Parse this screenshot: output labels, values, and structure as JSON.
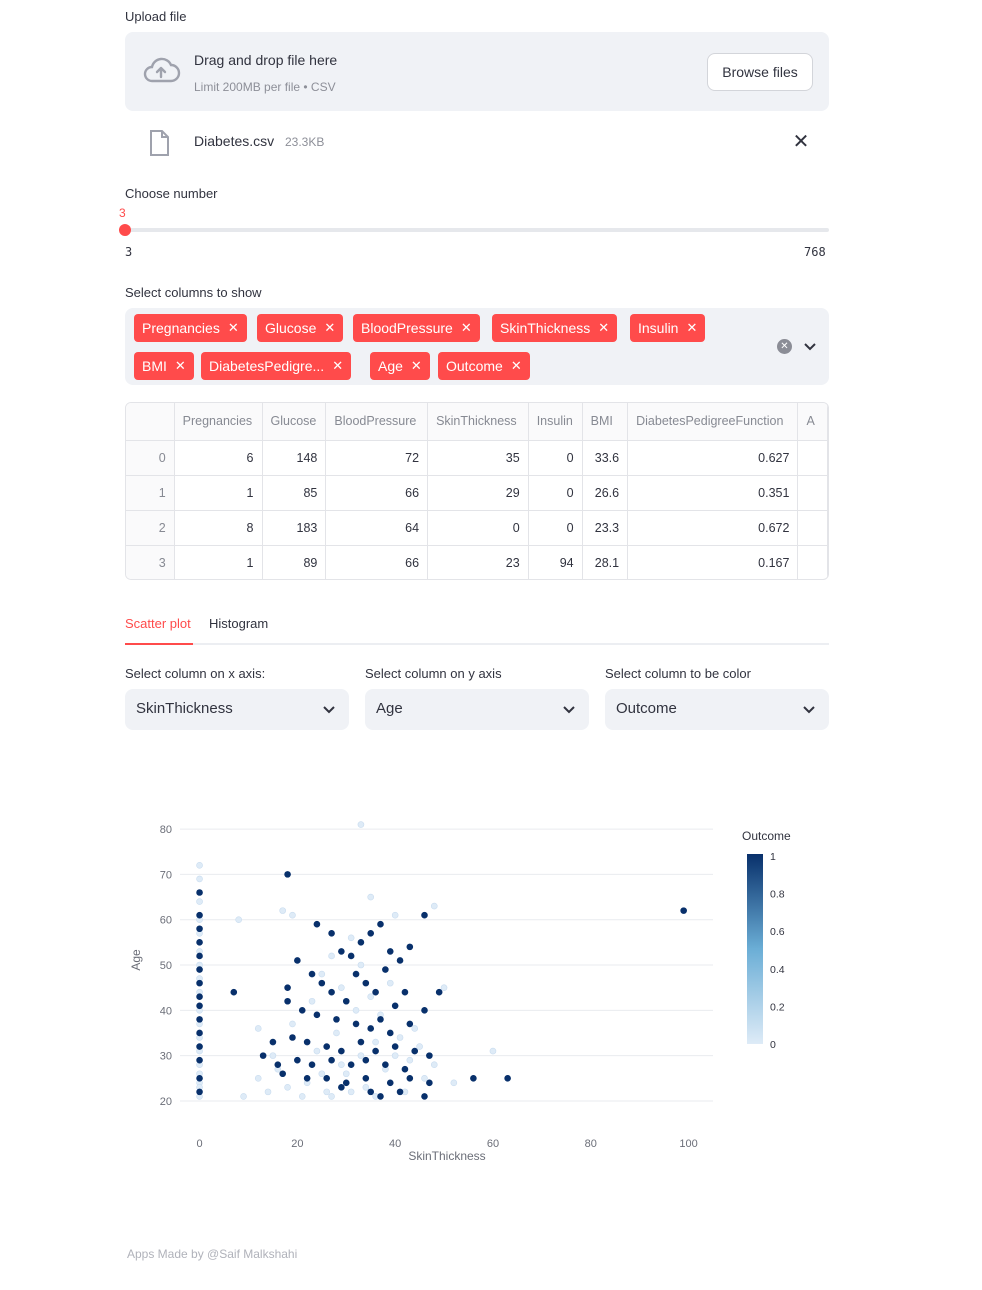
{
  "uploader": {
    "label": "Upload file",
    "drop_title": "Drag and drop file here",
    "drop_subtitle": "Limit 200MB per file • CSV",
    "browse_label": "Browse files",
    "file_name": "Diabetes.csv",
    "file_size": "23.3KB",
    "icons": [
      "cloud-upload-icon",
      "file-icon",
      "close-icon"
    ]
  },
  "slider": {
    "label": "Choose number",
    "value": "3",
    "min": "3",
    "max": "768",
    "accent": "#ff4b4b"
  },
  "multiselect": {
    "label": "Select columns to show",
    "chips": [
      "Pregnancies",
      "Glucose",
      "BloodPressure",
      "SkinThickness",
      "Insulin",
      "BMI",
      "DiabetesPedigre...",
      "Age",
      "Outcome"
    ]
  },
  "table": {
    "columns": [
      "Pregnancies",
      "Glucose",
      "BloodPressure",
      "SkinThickness",
      "Insulin",
      "BMI",
      "DiabetesPedigreeFunction",
      "A"
    ],
    "rows": [
      {
        "index": "0",
        "cells": [
          "6",
          "148",
          "72",
          "35",
          "0",
          "33.6",
          "0.627",
          ""
        ]
      },
      {
        "index": "1",
        "cells": [
          "1",
          "85",
          "66",
          "29",
          "0",
          "26.6",
          "0.351",
          ""
        ]
      },
      {
        "index": "2",
        "cells": [
          "8",
          "183",
          "64",
          "0",
          "0",
          "23.3",
          "0.672",
          ""
        ]
      },
      {
        "index": "3",
        "cells": [
          "1",
          "89",
          "66",
          "23",
          "94",
          "28.1",
          "0.167",
          ""
        ]
      }
    ]
  },
  "tabs": {
    "items": [
      "Scatter plot",
      "Histogram"
    ],
    "active": "Scatter plot"
  },
  "selects": [
    {
      "label": "Select column on x axis:",
      "value": "SkinThickness"
    },
    {
      "label": "Select column on y axis",
      "value": "Age"
    },
    {
      "label": "Select column to be color",
      "value": "Outcome"
    }
  ],
  "chart_data": {
    "type": "scatter",
    "xlabel": "SkinThickness",
    "ylabel": "Age",
    "xlim": [
      -4,
      105
    ],
    "ylim": [
      18,
      82
    ],
    "x_ticks": [
      0,
      20,
      40,
      60,
      80,
      100
    ],
    "y_ticks": [
      20,
      30,
      40,
      50,
      60,
      70,
      80
    ],
    "colorbar": {
      "title": "Outcome",
      "ticks": [
        "1",
        "0.8",
        "0.6",
        "0.4",
        "0.2",
        "0"
      ],
      "low_color": "#deebf7",
      "high_color": "#08306b"
    },
    "grid": true,
    "points": [
      {
        "x": 18,
        "y": 70,
        "c": 1
      },
      {
        "x": 99,
        "y": 62,
        "c": 1
      },
      {
        "x": 7,
        "y": 44,
        "c": 1
      },
      {
        "x": 0,
        "y": 66,
        "c": 1
      },
      {
        "x": 0,
        "y": 61,
        "c": 1
      },
      {
        "x": 0,
        "y": 58,
        "c": 1
      },
      {
        "x": 0,
        "y": 55,
        "c": 1
      },
      {
        "x": 0,
        "y": 52,
        "c": 1
      },
      {
        "x": 0,
        "y": 49,
        "c": 1
      },
      {
        "x": 0,
        "y": 46,
        "c": 1
      },
      {
        "x": 0,
        "y": 43,
        "c": 1
      },
      {
        "x": 0,
        "y": 41,
        "c": 1
      },
      {
        "x": 0,
        "y": 38,
        "c": 1
      },
      {
        "x": 0,
        "y": 35,
        "c": 1
      },
      {
        "x": 0,
        "y": 32,
        "c": 1
      },
      {
        "x": 0,
        "y": 29,
        "c": 1
      },
      {
        "x": 0,
        "y": 25,
        "c": 1
      },
      {
        "x": 0,
        "y": 22,
        "c": 1
      },
      {
        "x": 0,
        "y": 72,
        "c": 0
      },
      {
        "x": 0,
        "y": 69,
        "c": 0
      },
      {
        "x": 0,
        "y": 64,
        "c": 0
      },
      {
        "x": 0,
        "y": 60,
        "c": 0
      },
      {
        "x": 0,
        "y": 57,
        "c": 0
      },
      {
        "x": 0,
        "y": 53,
        "c": 0
      },
      {
        "x": 0,
        "y": 50,
        "c": 0
      },
      {
        "x": 0,
        "y": 47,
        "c": 0
      },
      {
        "x": 0,
        "y": 44,
        "c": 0
      },
      {
        "x": 0,
        "y": 40,
        "c": 0
      },
      {
        "x": 0,
        "y": 37,
        "c": 0
      },
      {
        "x": 0,
        "y": 34,
        "c": 0
      },
      {
        "x": 0,
        "y": 31,
        "c": 0
      },
      {
        "x": 0,
        "y": 28,
        "c": 0
      },
      {
        "x": 0,
        "y": 26,
        "c": 0
      },
      {
        "x": 0,
        "y": 24,
        "c": 0
      },
      {
        "x": 0,
        "y": 23,
        "c": 0
      },
      {
        "x": 0,
        "y": 21,
        "c": 0
      },
      {
        "x": 33,
        "y": 81,
        "c": 0
      },
      {
        "x": 17,
        "y": 62,
        "c": 0
      },
      {
        "x": 19,
        "y": 61,
        "c": 0
      },
      {
        "x": 8,
        "y": 60,
        "c": 0
      },
      {
        "x": 35,
        "y": 65,
        "c": 0
      },
      {
        "x": 48,
        "y": 63,
        "c": 0
      },
      {
        "x": 40,
        "y": 61,
        "c": 0
      },
      {
        "x": 50,
        "y": 45,
        "c": 0
      },
      {
        "x": 60,
        "y": 31,
        "c": 0
      },
      {
        "x": 12,
        "y": 36,
        "c": 0
      },
      {
        "x": 9,
        "y": 21,
        "c": 0
      },
      {
        "x": 12,
        "y": 25,
        "c": 0
      },
      {
        "x": 14,
        "y": 22,
        "c": 0
      },
      {
        "x": 16,
        "y": 27,
        "c": 0
      },
      {
        "x": 18,
        "y": 23,
        "c": 0
      },
      {
        "x": 20,
        "y": 29,
        "c": 0
      },
      {
        "x": 22,
        "y": 24,
        "c": 0
      },
      {
        "x": 24,
        "y": 31,
        "c": 0
      },
      {
        "x": 26,
        "y": 22,
        "c": 0
      },
      {
        "x": 28,
        "y": 35,
        "c": 0
      },
      {
        "x": 30,
        "y": 26,
        "c": 0
      },
      {
        "x": 32,
        "y": 40,
        "c": 0
      },
      {
        "x": 34,
        "y": 23,
        "c": 0
      },
      {
        "x": 36,
        "y": 33,
        "c": 0
      },
      {
        "x": 38,
        "y": 27,
        "c": 0
      },
      {
        "x": 40,
        "y": 30,
        "c": 0
      },
      {
        "x": 42,
        "y": 22,
        "c": 0
      },
      {
        "x": 44,
        "y": 36,
        "c": 0
      },
      {
        "x": 46,
        "y": 25,
        "c": 0
      },
      {
        "x": 48,
        "y": 28,
        "c": 0
      },
      {
        "x": 15,
        "y": 30,
        "c": 0
      },
      {
        "x": 19,
        "y": 37,
        "c": 0
      },
      {
        "x": 23,
        "y": 42,
        "c": 0
      },
      {
        "x": 25,
        "y": 48,
        "c": 0
      },
      {
        "x": 27,
        "y": 52,
        "c": 0
      },
      {
        "x": 29,
        "y": 45,
        "c": 0
      },
      {
        "x": 31,
        "y": 56,
        "c": 0
      },
      {
        "x": 33,
        "y": 50,
        "c": 0
      },
      {
        "x": 35,
        "y": 43,
        "c": 0
      },
      {
        "x": 37,
        "y": 39,
        "c": 0
      },
      {
        "x": 39,
        "y": 46,
        "c": 0
      },
      {
        "x": 41,
        "y": 34,
        "c": 0
      },
      {
        "x": 43,
        "y": 29,
        "c": 0
      },
      {
        "x": 21,
        "y": 21,
        "c": 0
      },
      {
        "x": 27,
        "y": 21,
        "c": 0
      },
      {
        "x": 31,
        "y": 22,
        "c": 0
      },
      {
        "x": 36,
        "y": 21,
        "c": 0
      },
      {
        "x": 25,
        "y": 26,
        "c": 0
      },
      {
        "x": 29,
        "y": 28,
        "c": 0
      },
      {
        "x": 33,
        "y": 30,
        "c": 0
      },
      {
        "x": 45,
        "y": 32,
        "c": 0
      },
      {
        "x": 52,
        "y": 24,
        "c": 0
      },
      {
        "x": 24,
        "y": 59,
        "c": 1
      },
      {
        "x": 27,
        "y": 57,
        "c": 1
      },
      {
        "x": 29,
        "y": 53,
        "c": 1
      },
      {
        "x": 31,
        "y": 52,
        "c": 1
      },
      {
        "x": 33,
        "y": 55,
        "c": 1
      },
      {
        "x": 35,
        "y": 57,
        "c": 1
      },
      {
        "x": 37,
        "y": 59,
        "c": 1
      },
      {
        "x": 39,
        "y": 53,
        "c": 1
      },
      {
        "x": 41,
        "y": 51,
        "c": 1
      },
      {
        "x": 43,
        "y": 54,
        "c": 1
      },
      {
        "x": 46,
        "y": 61,
        "c": 1
      },
      {
        "x": 20,
        "y": 51,
        "c": 1
      },
      {
        "x": 23,
        "y": 48,
        "c": 1
      },
      {
        "x": 25,
        "y": 46,
        "c": 1
      },
      {
        "x": 27,
        "y": 44,
        "c": 1
      },
      {
        "x": 30,
        "y": 42,
        "c": 1
      },
      {
        "x": 32,
        "y": 48,
        "c": 1
      },
      {
        "x": 34,
        "y": 46,
        "c": 1
      },
      {
        "x": 36,
        "y": 44,
        "c": 1
      },
      {
        "x": 38,
        "y": 49,
        "c": 1
      },
      {
        "x": 40,
        "y": 41,
        "c": 1
      },
      {
        "x": 42,
        "y": 44,
        "c": 1
      },
      {
        "x": 46,
        "y": 40,
        "c": 1
      },
      {
        "x": 49,
        "y": 44,
        "c": 1
      },
      {
        "x": 18,
        "y": 45,
        "c": 1
      },
      {
        "x": 18,
        "y": 42,
        "c": 1
      },
      {
        "x": 21,
        "y": 40,
        "c": 1
      },
      {
        "x": 24,
        "y": 39,
        "c": 1
      },
      {
        "x": 28,
        "y": 38,
        "c": 1
      },
      {
        "x": 32,
        "y": 37,
        "c": 1
      },
      {
        "x": 35,
        "y": 36,
        "c": 1
      },
      {
        "x": 37,
        "y": 38,
        "c": 1
      },
      {
        "x": 39,
        "y": 35,
        "c": 1
      },
      {
        "x": 43,
        "y": 37,
        "c": 1
      },
      {
        "x": 15,
        "y": 33,
        "c": 1
      },
      {
        "x": 19,
        "y": 34,
        "c": 1
      },
      {
        "x": 22,
        "y": 33,
        "c": 1
      },
      {
        "x": 26,
        "y": 32,
        "c": 1
      },
      {
        "x": 29,
        "y": 31,
        "c": 1
      },
      {
        "x": 33,
        "y": 33,
        "c": 1
      },
      {
        "x": 36,
        "y": 31,
        "c": 1
      },
      {
        "x": 40,
        "y": 32,
        "c": 1
      },
      {
        "x": 44,
        "y": 31,
        "c": 1
      },
      {
        "x": 47,
        "y": 30,
        "c": 1
      },
      {
        "x": 13,
        "y": 30,
        "c": 1
      },
      {
        "x": 16,
        "y": 28,
        "c": 1
      },
      {
        "x": 20,
        "y": 29,
        "c": 1
      },
      {
        "x": 23,
        "y": 28,
        "c": 1
      },
      {
        "x": 27,
        "y": 29,
        "c": 1
      },
      {
        "x": 31,
        "y": 28,
        "c": 1
      },
      {
        "x": 34,
        "y": 29,
        "c": 1
      },
      {
        "x": 38,
        "y": 28,
        "c": 1
      },
      {
        "x": 42,
        "y": 27,
        "c": 1
      },
      {
        "x": 17,
        "y": 26,
        "c": 1
      },
      {
        "x": 22,
        "y": 25,
        "c": 1
      },
      {
        "x": 26,
        "y": 25,
        "c": 1
      },
      {
        "x": 30,
        "y": 24,
        "c": 1
      },
      {
        "x": 34,
        "y": 25,
        "c": 1
      },
      {
        "x": 39,
        "y": 24,
        "c": 1
      },
      {
        "x": 43,
        "y": 25,
        "c": 1
      },
      {
        "x": 56,
        "y": 25,
        "c": 1
      },
      {
        "x": 63,
        "y": 25,
        "c": 1
      },
      {
        "x": 29,
        "y": 23,
        "c": 1
      },
      {
        "x": 35,
        "y": 22,
        "c": 1
      },
      {
        "x": 37,
        "y": 21,
        "c": 1
      },
      {
        "x": 46,
        "y": 21,
        "c": 1
      },
      {
        "x": 41,
        "y": 22,
        "c": 1
      },
      {
        "x": 47,
        "y": 24,
        "c": 1
      }
    ]
  },
  "footer": {
    "text": "Apps Made by @Saif Malkshahi"
  }
}
